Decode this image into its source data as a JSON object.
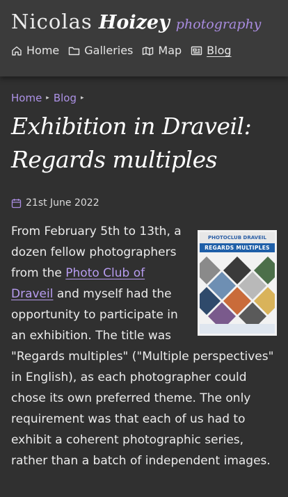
{
  "brand": {
    "first": "Nicolas",
    "last": "Hoizey",
    "tag": "photography"
  },
  "nav": [
    {
      "label": "Home",
      "icon": "home-icon"
    },
    {
      "label": "Galleries",
      "icon": "folder-icon"
    },
    {
      "label": "Map",
      "icon": "map-icon"
    },
    {
      "label": "Blog",
      "icon": "news-icon",
      "active": true
    }
  ],
  "breadcrumb": {
    "home": "Home",
    "blog": "Blog"
  },
  "title": "Exhibition in Draveil: Regards multiples",
  "date": "21st June 2022",
  "article": {
    "p1_before_link": "From February 5th to 13th, a dozen fellow photographers from the ",
    "link": "Photo Club of Draveil",
    "p1_after_link": " and myself had the opportunity to participate in an exhibition. The title was \"Regards multiples\" (\"Multiple perspectives\" in English), as each photographer could chose its own preferred theme. The only requirement was that each of us had to exhibit a coherent photographic series, rather than a batch of independent images."
  },
  "poster": {
    "club": "PHOTOCLUB DRAVEIL",
    "headline": "REGARDS MULTIPLES"
  },
  "colors": {
    "accent": "#ad92e6",
    "background": "#303030",
    "header": "#3b3b3b"
  }
}
